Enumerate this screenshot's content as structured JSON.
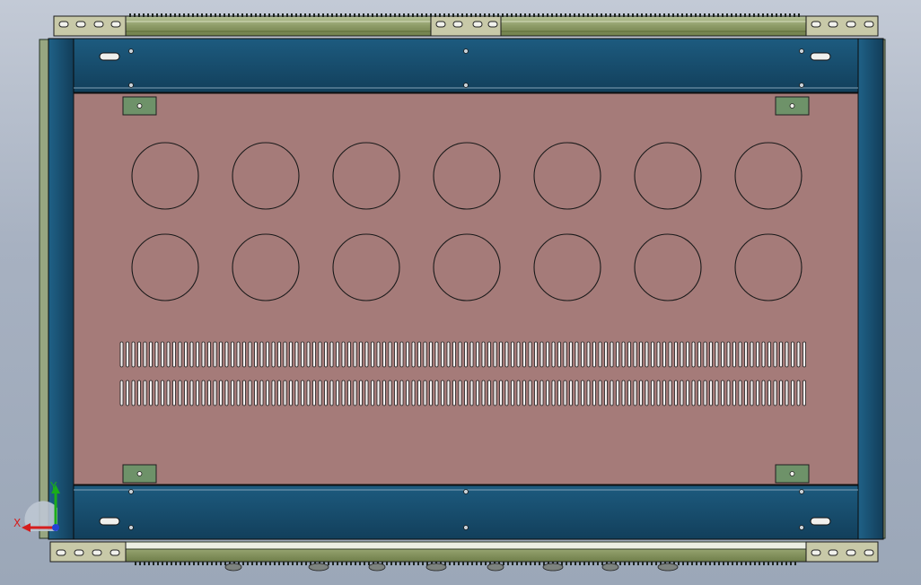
{
  "viewport": {
    "background_top": "#c3cad6",
    "background_bottom": "#9ba7b8"
  },
  "assembly": {
    "panel_color": "#a57b79",
    "frame_color": "#174d6d",
    "rail_color": "#8d9b67",
    "bracket_color": "#6e9269",
    "edge_color": "#101010",
    "hole_rows": 2,
    "holes_per_row": 7,
    "vent_rows": 2,
    "vents_per_row": 118
  },
  "triad": {
    "x_label": "X",
    "y_label": "Y",
    "x_color": "#d51d1d",
    "y_color": "#1aad1a",
    "z_color": "#2343d6"
  }
}
